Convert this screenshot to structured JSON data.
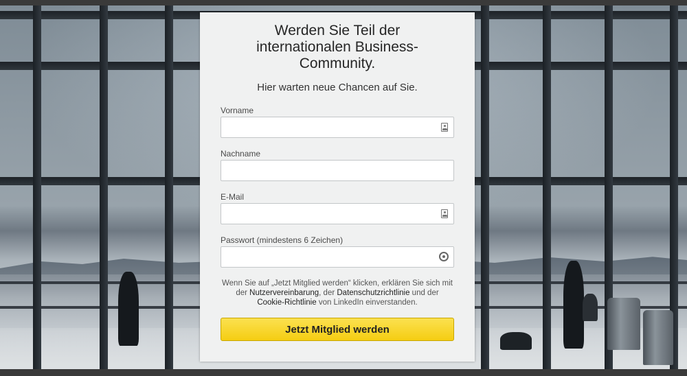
{
  "form": {
    "headline": "Werden Sie Teil der internationalen Business-Community.",
    "subline": "Hier warten neue Chancen auf Sie.",
    "fields": [
      {
        "label": "Vorname",
        "value": "",
        "icon": "autofill-contact-icon"
      },
      {
        "label": "Nachname",
        "value": ""
      },
      {
        "label": "E-Mail",
        "value": "",
        "icon": "autofill-contact-icon"
      },
      {
        "label": "Passwort (mindestens 6 Zeichen)",
        "value": "",
        "icon": "password-key-icon"
      }
    ],
    "legal": {
      "part1": "Wenn Sie auf „Jetzt Mitglied werden“ klicken, erklären Sie sich mit der ",
      "link_user_agreement": "Nutzervereinbarung",
      "part2": ", der ",
      "link_privacy": "Datenschutzrichtlinie",
      "part3": " und der ",
      "link_cookie": "Cookie-Richtlinie",
      "part4": " von LinkedIn einverstanden."
    },
    "submit_label": "Jetzt Mitglied werden"
  },
  "colors": {
    "button": "#f5cd12",
    "card": "#f0f1f1"
  }
}
